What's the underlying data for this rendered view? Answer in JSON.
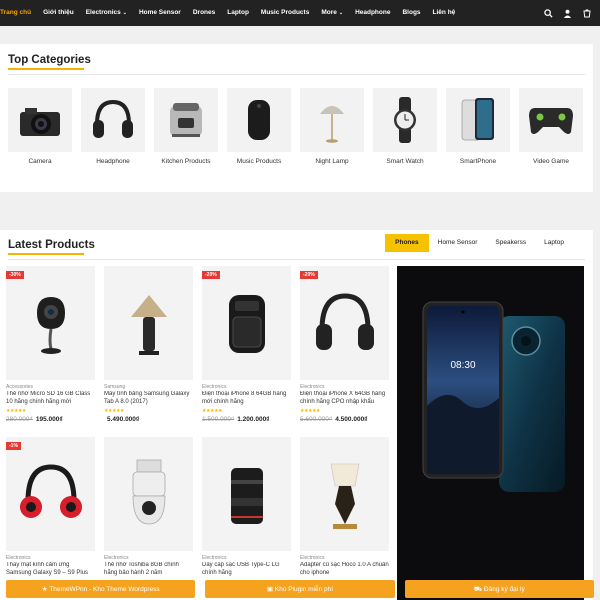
{
  "nav": {
    "items": [
      {
        "label": "Trang chủ",
        "active": true
      },
      {
        "label": "Giới thiệu"
      },
      {
        "label": "Electronics",
        "dropdown": true
      },
      {
        "label": "Home Sensor"
      },
      {
        "label": "Drones"
      },
      {
        "label": "Laptop"
      },
      {
        "label": "Music Products"
      },
      {
        "label": "More",
        "dropdown": true
      },
      {
        "label": "Headphone"
      },
      {
        "label": "Blogs"
      },
      {
        "label": "Liên hệ"
      }
    ],
    "icons": [
      "search-icon",
      "user-icon",
      "cart-icon"
    ]
  },
  "top_categories": {
    "title": "Top Categories",
    "items": [
      {
        "label": "Camera",
        "icon": "camera-icon"
      },
      {
        "label": "Headphone",
        "icon": "headphone-icon"
      },
      {
        "label": "Kitchen Products",
        "icon": "kitchen-icon"
      },
      {
        "label": "Music Products",
        "icon": "speaker-icon"
      },
      {
        "label": "Night Lamp",
        "icon": "lamp-icon"
      },
      {
        "label": "Smart Watch",
        "icon": "watch-icon"
      },
      {
        "label": "SmartPhone",
        "icon": "phone-icon"
      },
      {
        "label": "Video Game",
        "icon": "gamepad-icon"
      }
    ]
  },
  "latest": {
    "title": "Latest Products",
    "tabs": [
      {
        "label": "Phones",
        "active": true
      },
      {
        "label": "Home Sensor"
      },
      {
        "label": "Speakerss"
      },
      {
        "label": "Laptop"
      }
    ],
    "products": [
      {
        "badge": "-30%",
        "category": "Accessories",
        "name": "Thẻ nhớ Micro SD 16 GB Class 10 hãng chính hãng mới",
        "stars": "★★★★★",
        "old_price": "280.000₫",
        "price": "195.000₫",
        "icon": "security-camera-icon"
      },
      {
        "badge": "",
        "category": "Samsung",
        "name": "Máy tính bảng Samsung Galaxy Tab A 8.0 (2017)",
        "stars": "★★★★★",
        "old_price": "",
        "price": "5.490.000₫",
        "icon": "table-lamp-icon"
      },
      {
        "badge": "-20%",
        "category": "Electronics",
        "name": "Điện thoại iPhone 8 64GB hàng mới chính hãng",
        "stars": "★★★★★",
        "old_price": "1.500.000₫",
        "price": "1.200.000₫",
        "icon": "air-fryer-icon"
      },
      {
        "badge": "-20%",
        "category": "Electronics",
        "name": "Điện thoại iPhone X 64GB hàng chính hãng CPO nhập khẩu",
        "stars": "★★★★★",
        "old_price": "5.600.000₫",
        "price": "4.500.000₫",
        "icon": "headphone-icon"
      },
      {
        "badge": "-1%",
        "category": "Electronics",
        "name": "Thay mặt kính cảm ứng Samsung Galaxy S9 – S9 Plus",
        "stars": "",
        "old_price": "",
        "price": "",
        "icon": "beats-headphone-icon"
      },
      {
        "badge": "",
        "category": "Electronics",
        "name": "Thẻ nhớ Toshiba 8GB chính hãng bảo hành 2 năm",
        "stars": "",
        "old_price": "",
        "price": "",
        "icon": "dome-camera-icon"
      },
      {
        "badge": "",
        "category": "Electronics",
        "name": "Dây cáp sạc USB Type-C LG chính hãng",
        "stars": "",
        "old_price": "",
        "price": "",
        "icon": "lens-icon"
      },
      {
        "badge": "",
        "category": "Electronics",
        "name": "Adapter củ sạc Hoco 1.0 A chuẩn cho iphone",
        "stars": "",
        "old_price": "",
        "price": "",
        "icon": "desk-lamp-icon"
      }
    ],
    "banner": {
      "time": "08:30",
      "icon": "smartphone-banner"
    }
  },
  "bottom_bar": [
    {
      "label": "ThemeWPnn - Kho Theme Wordpress",
      "icon": "star-icon"
    },
    {
      "label": "Kho Plugin miễn phí",
      "icon": "gift-icon"
    },
    {
      "label": "Đăng ký đại lý",
      "icon": "cart-icon"
    }
  ],
  "colors": {
    "accent": "#f6b400",
    "badge": "#e53935",
    "bottom_bar": "#f5a31e",
    "nav_bg": "#222222",
    "nav_active": "#f6a300"
  }
}
